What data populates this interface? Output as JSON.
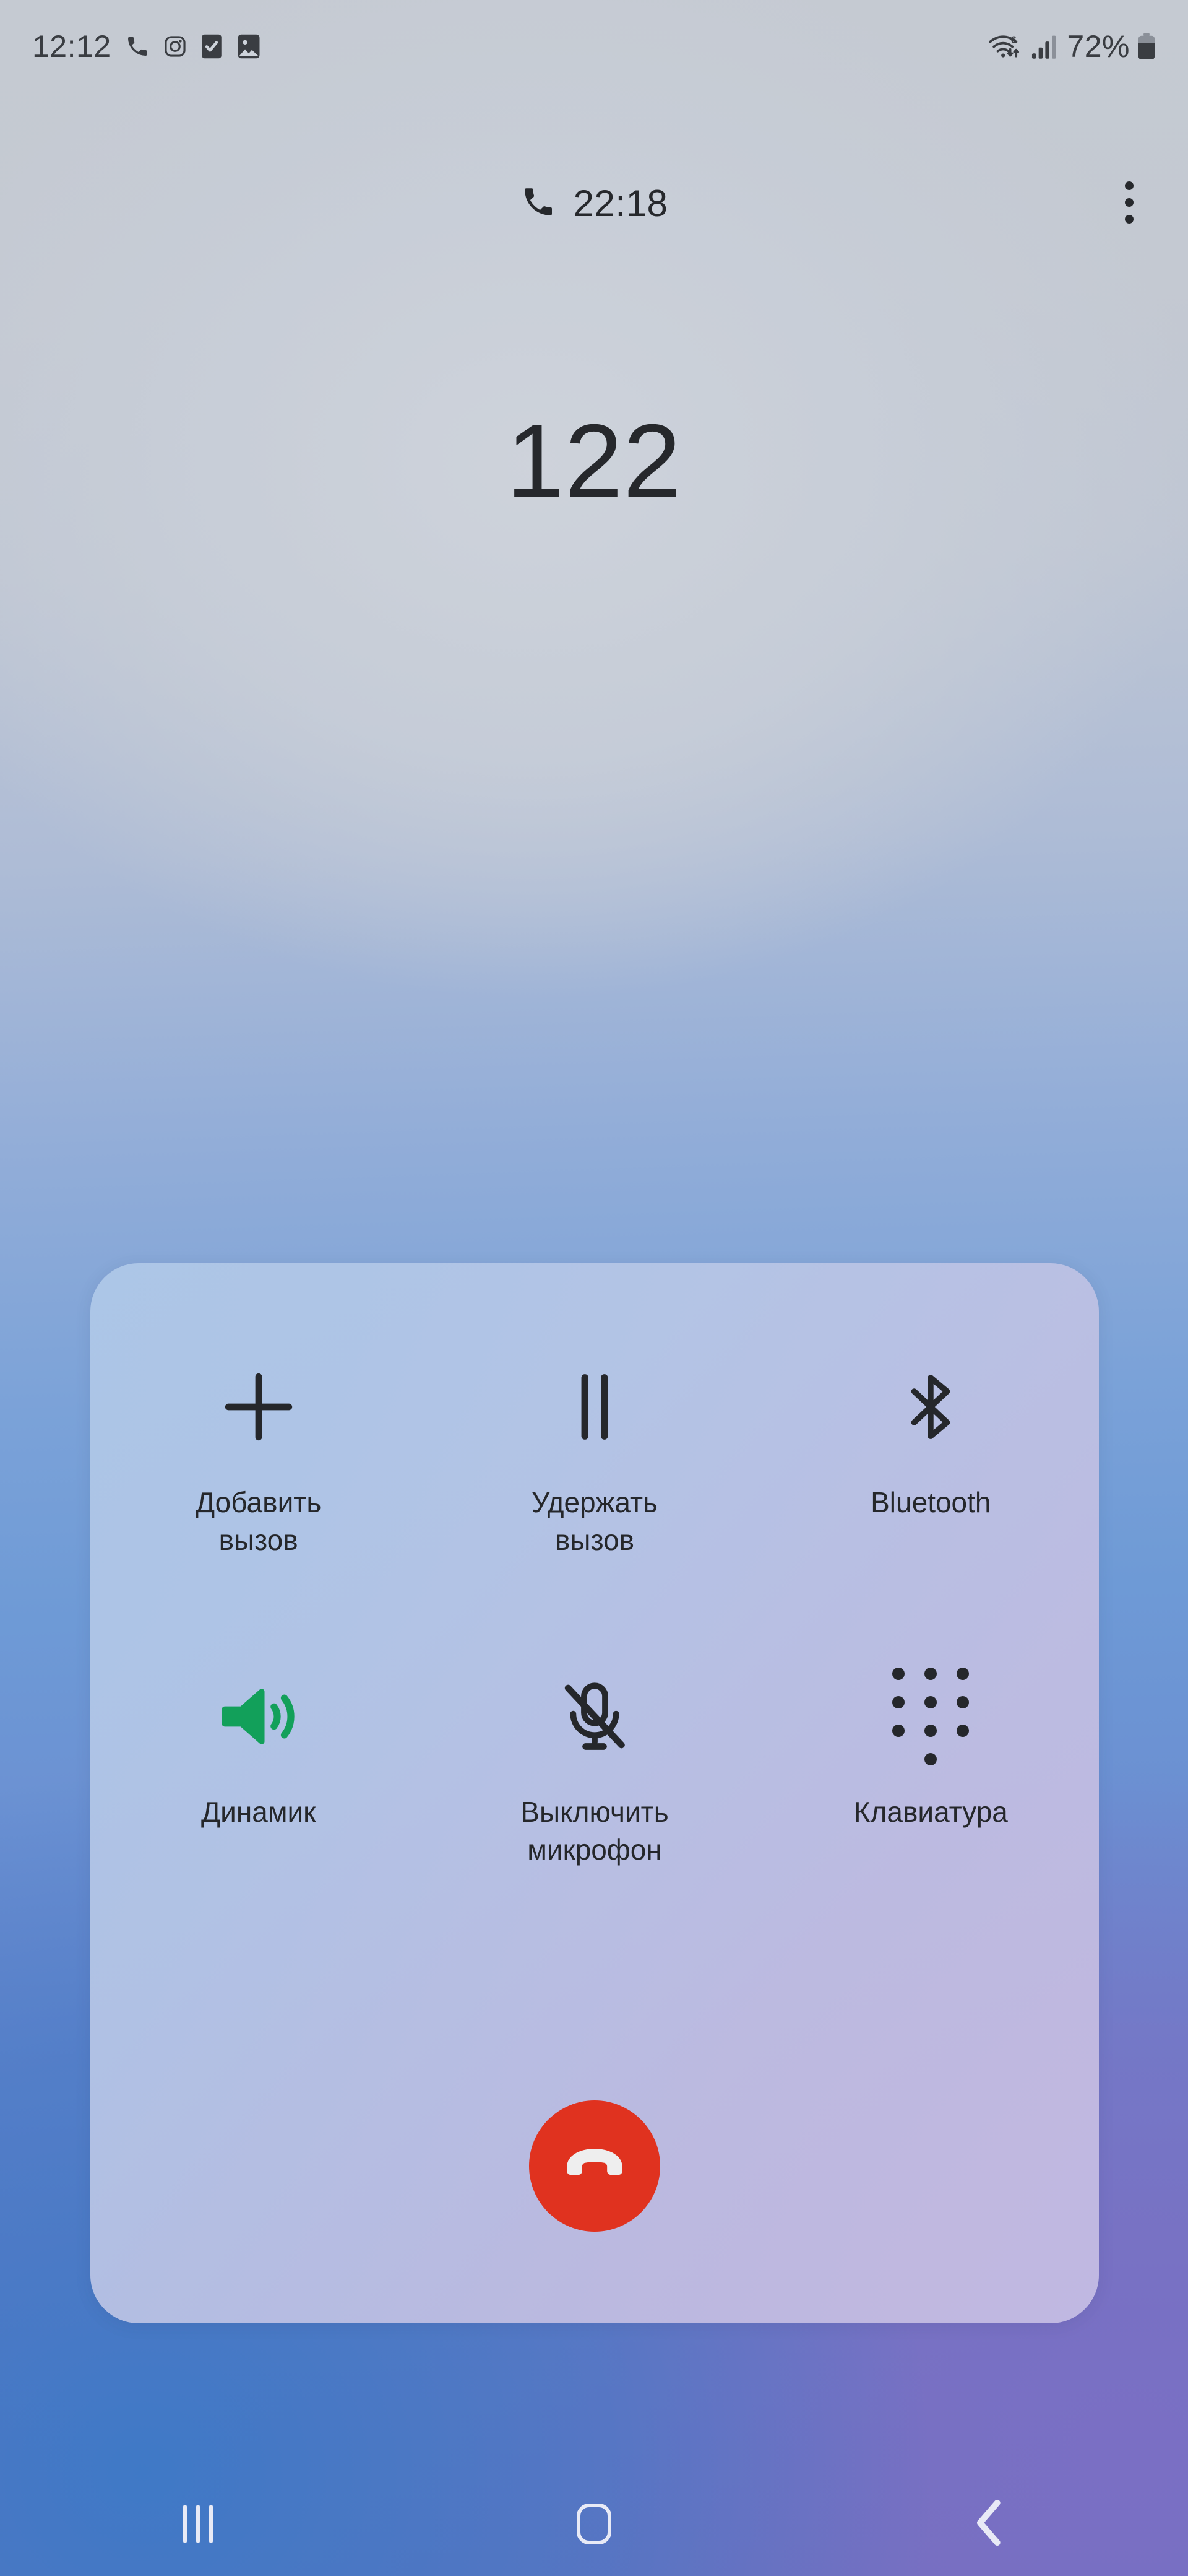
{
  "status_bar": {
    "time": "12:12",
    "battery_percent": "72%",
    "icons": [
      "phone-call-icon",
      "instagram-icon",
      "checkbox-icon",
      "gallery-image-icon"
    ],
    "right_icons": [
      "wifi-6-icon",
      "cellular-signal-icon",
      "battery-icon"
    ],
    "wifi_label": "6"
  },
  "call_header": {
    "duration": "22:18",
    "phone_icon": "phone-handset-icon",
    "menu_icon": "overflow-menu-icon"
  },
  "caller": {
    "number": "122"
  },
  "controls": {
    "tiles": [
      {
        "label": "Добавить\nвызов",
        "icon": "add-call-icon",
        "name": "add-call",
        "active": false
      },
      {
        "label": "Удержать\nвызов",
        "icon": "hold-call-pause-icon",
        "name": "hold-call",
        "active": false
      },
      {
        "label": "Bluetooth",
        "icon": "bluetooth-icon",
        "name": "bluetooth",
        "active": false
      },
      {
        "label": "Динамик",
        "icon": "speaker-icon",
        "name": "speaker",
        "active": true
      },
      {
        "label": "Выключить\nмикрофон",
        "icon": "microphone-off-icon",
        "name": "mute-microphone",
        "active": false
      },
      {
        "label": "Клавиатура",
        "icon": "dialpad-icon",
        "name": "keypad",
        "active": false
      }
    ],
    "end_call": {
      "icon": "end-call-handset-icon",
      "color": "#e0321f"
    },
    "active_color": "#12a05a",
    "icon_color": "#25272b"
  },
  "nav_bar": {
    "items": [
      {
        "name": "recents",
        "icon": "recents-icon"
      },
      {
        "name": "home",
        "icon": "home-icon"
      },
      {
        "name": "back",
        "icon": "back-chevron-icon"
      }
    ]
  },
  "theme": {
    "panel_tint": "#b8c5e4",
    "text_dark": "#25272b",
    "nav_icon": "#e8eaf6"
  }
}
